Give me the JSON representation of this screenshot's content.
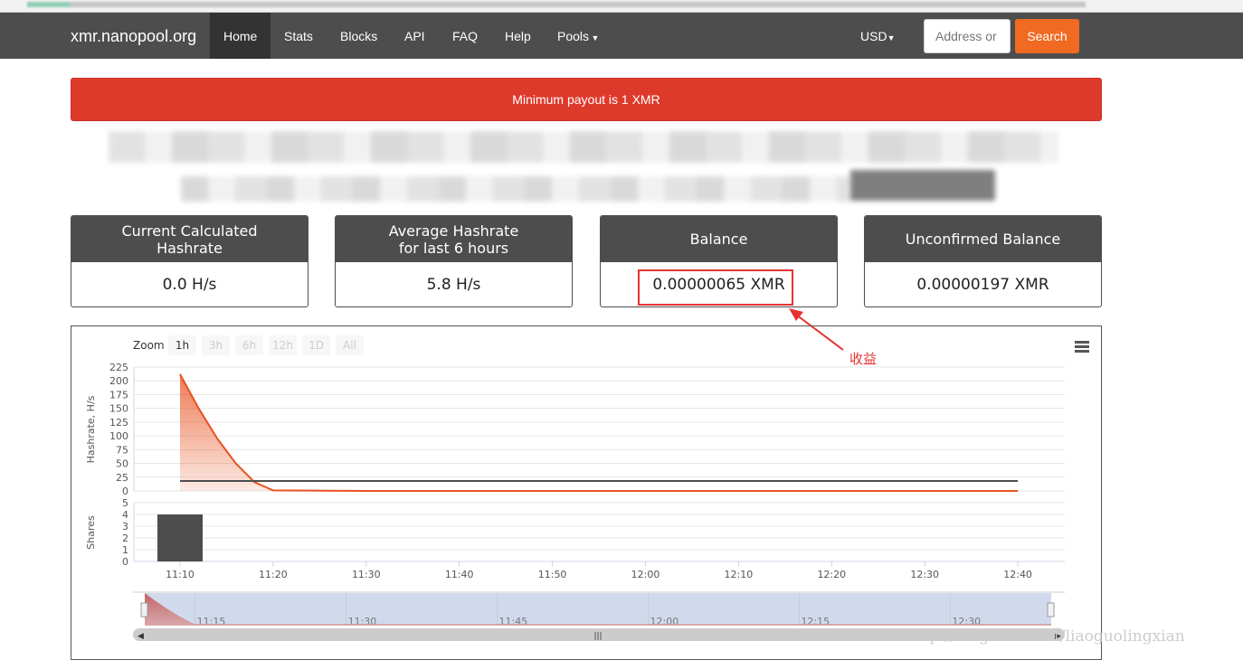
{
  "nav": {
    "brand": "xmr.nanopool.org",
    "items": [
      "Home",
      "Stats",
      "Blocks",
      "API",
      "FAQ",
      "Help",
      "Pools"
    ],
    "active": "Home",
    "currency": "USD",
    "address_placeholder": "Address or",
    "search_label": "Search"
  },
  "alert": {
    "text": "Minimum payout is 1 XMR"
  },
  "cards": [
    {
      "title": "Current Calculated\nHashrate",
      "value": "0.0 H/s"
    },
    {
      "title": "Average Hashrate\nfor last 6 hours",
      "value": "5.8 H/s"
    },
    {
      "title": "Balance",
      "value": "0.00000065 XMR"
    },
    {
      "title": "Unconfirmed Balance",
      "value": "0.00000197 XMR"
    }
  ],
  "annotation": {
    "text": "收益",
    "color": "#e53333"
  },
  "chart": {
    "zoom_label": "Zoom",
    "zoom_buttons": [
      "1h",
      "3h",
      "6h",
      "12h",
      "1D",
      "All"
    ],
    "zoom_selected": "1h",
    "navigator_ticks": [
      "11:15",
      "11:30",
      "11:45",
      "12:00",
      "12:15",
      "12:30"
    ]
  },
  "watermark": "http://blog.csdn.net/liaoguolingxian",
  "chart_data": [
    {
      "type": "area",
      "ylabel": "Hashrate, H/s",
      "ylim": [
        0,
        225
      ],
      "yticks": [
        0,
        25,
        50,
        75,
        100,
        125,
        150,
        175,
        200,
        225
      ],
      "xticks": [
        "11:10",
        "11:20",
        "11:30",
        "11:40",
        "11:50",
        "12:00",
        "12:10",
        "12:20",
        "12:30",
        "12:40"
      ],
      "x": [
        "11:10",
        "11:12",
        "11:14",
        "11:16",
        "11:18",
        "11:20",
        "11:30",
        "11:40",
        "11:50",
        "12:00",
        "12:10",
        "12:20",
        "12:30",
        "12:40"
      ],
      "series": [
        {
          "values": [
            212,
            150,
            95,
            50,
            16,
            1,
            0,
            0,
            0,
            0,
            0,
            0,
            0,
            0
          ],
          "color": "#e8511f"
        }
      ],
      "average": {
        "value": 18,
        "color": "#4d4d4d"
      }
    },
    {
      "type": "bar",
      "ylabel": "Shares",
      "ylim": [
        0,
        5
      ],
      "yticks": [
        0,
        1,
        2,
        3,
        4,
        5
      ],
      "x": [
        "11:10"
      ],
      "values": [
        4
      ],
      "color": "#4d4d4d"
    }
  ]
}
